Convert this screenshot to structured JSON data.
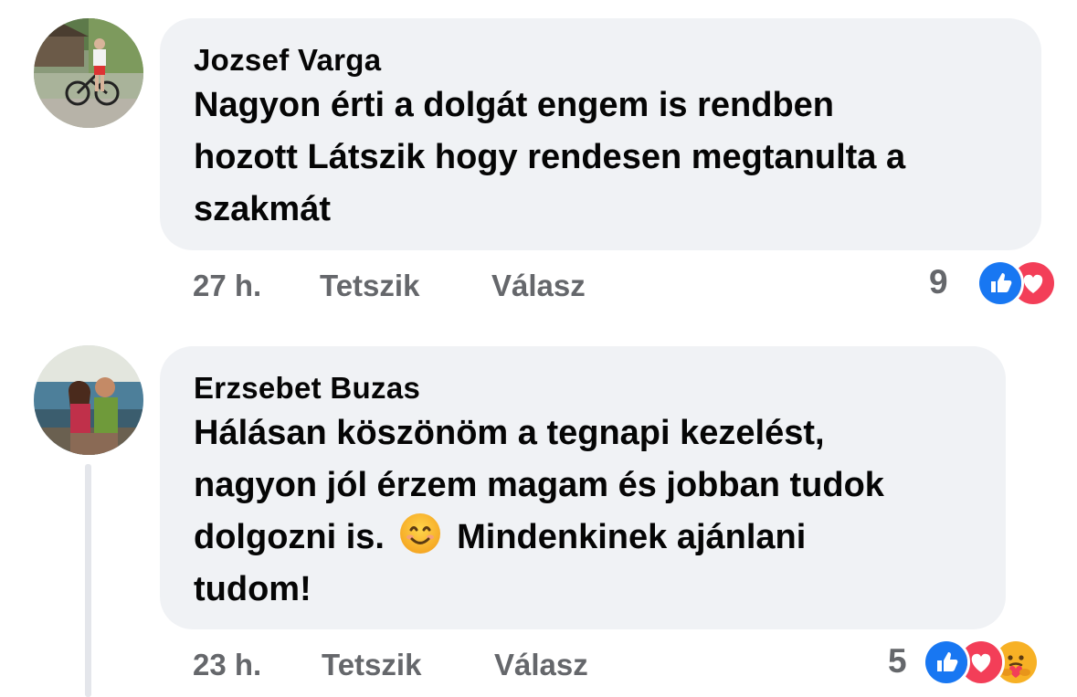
{
  "comments": [
    {
      "author": "Jozsef Varga",
      "text_lines": [
        "Nagyon érti a dolgát engem is rendben",
        "hozott Látszik hogy rendesen megtanulta a",
        "szakmát"
      ],
      "time": "27 h.",
      "like_label": "Tetszik",
      "reply_label": "Válasz",
      "reaction_count": "9",
      "reactions": [
        "like-reaction-icon",
        "love-reaction-icon"
      ]
    },
    {
      "author": "Erzsebet Buzas",
      "text_lines": [
        "Hálásan köszönöm a tegnapi kezelést,",
        "nagyon jól érzem magam és jobban tudok",
        "dolgozni is.",
        "Mindenkinek ajánlani",
        "tudom!"
      ],
      "emoji": "smiling-face-emoji",
      "time": "23 h.",
      "like_label": "Tetszik",
      "reply_label": "Válasz",
      "reaction_count": "5",
      "reactions": [
        "like-reaction-icon",
        "love-reaction-icon",
        "care-reaction-icon"
      ]
    }
  ],
  "colors": {
    "bubble_bg": "#f0f2f5",
    "meta_text": "#65676b",
    "like_blue": "#1877f2",
    "love_red": "#f33e58",
    "care_yellow": "#f7b125"
  }
}
